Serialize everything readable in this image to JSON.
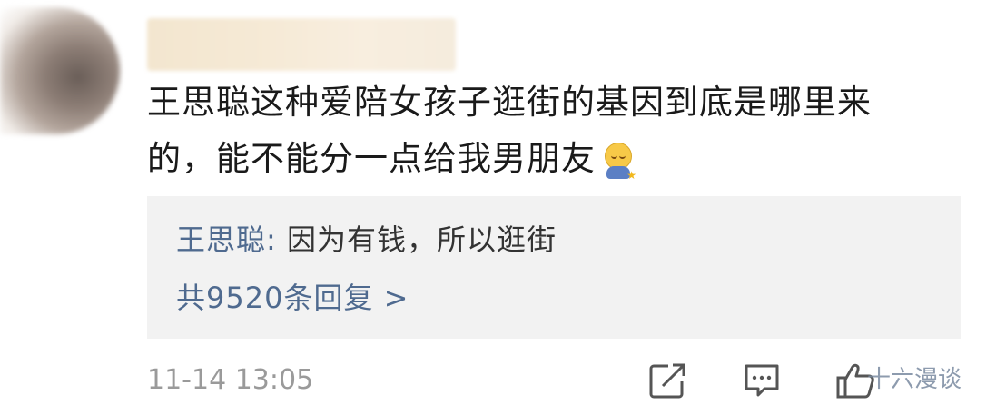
{
  "comment": {
    "line1": "王思聪这种爱陪女孩子逛街的基因到底是哪里来",
    "line2": "的，能不能分一点给我男朋友",
    "emoji": "shy-emoji"
  },
  "reply": {
    "author": "王思聪:",
    "text": " 因为有钱，所以逛街",
    "count_label": "共9520条回复 >"
  },
  "meta": {
    "timestamp": "11-14 13:05"
  },
  "actions": {
    "share_icon": "share-icon",
    "comment_icon": "comment-icon",
    "like_icon": "thumbs-up-icon"
  },
  "watermark": "十六漫谈",
  "colors": {
    "link": "#4f6a8f",
    "reply_bg": "#f2f2f2",
    "text": "#1a1a1a",
    "muted": "#9a9a9a"
  }
}
